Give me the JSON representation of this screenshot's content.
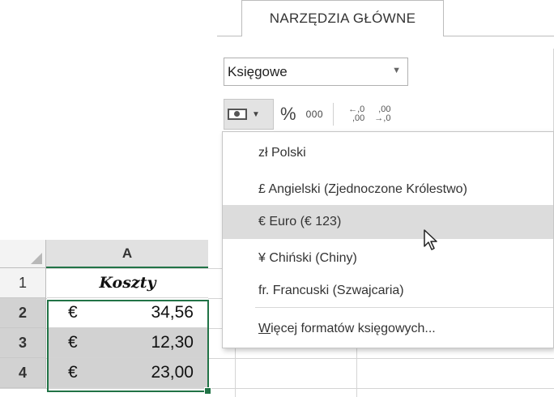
{
  "ribbon": {
    "tab_label": "NARZĘDZIA GŁÓWNE",
    "number_format": "Księgowe",
    "percent_label": "%",
    "thousands_label": "000",
    "increase_decimal": "←,0\n,00",
    "decrease_decimal": ",00\n→,0"
  },
  "accounting_menu": {
    "items": [
      {
        "label": "zł Polski"
      },
      {
        "label": "£ Angielski (Zjednoczone Królestwo)"
      },
      {
        "label": "€ Euro (€ 123)"
      },
      {
        "label": "¥ Chiński (Chiny)"
      },
      {
        "label": "fr. Francuski (Szwajcaria)"
      }
    ],
    "highlighted_index": 2,
    "more_prefix": "W",
    "more_rest": "ięcej formatów księgowych..."
  },
  "sheet": {
    "column_header": "A",
    "rows": [
      {
        "num": "1",
        "text": "Koszty"
      },
      {
        "num": "2",
        "symbol": "€",
        "value": "34,56"
      },
      {
        "num": "3",
        "symbol": "€",
        "value": "12,30"
      },
      {
        "num": "4",
        "symbol": "€",
        "value": "23,00"
      }
    ]
  },
  "colors": {
    "selection": "#217346",
    "highlight": "#dcdcdc"
  }
}
